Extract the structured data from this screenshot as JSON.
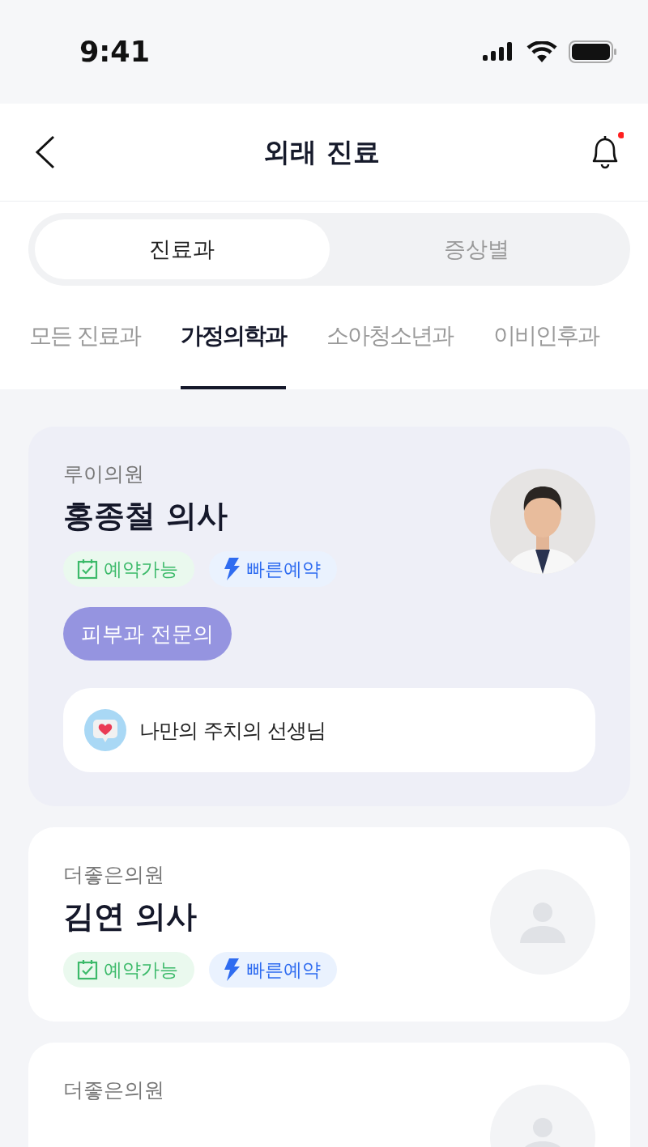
{
  "status_bar": {
    "time": "9:41"
  },
  "header": {
    "title": "외래 진료",
    "notification": true
  },
  "segments": [
    {
      "label": "진료과",
      "selected": true
    },
    {
      "label": "증상별",
      "selected": false
    }
  ],
  "categories": [
    {
      "label": "모든 진료과",
      "selected": false
    },
    {
      "label": "가정의학과",
      "selected": true
    },
    {
      "label": "소아청소년과",
      "selected": false
    },
    {
      "label": "이비인후과",
      "selected": false
    }
  ],
  "doctors": [
    {
      "clinic": "루이의원",
      "name": "홍종철 의사",
      "photo": true,
      "selected": true,
      "badges": [
        {
          "kind": "available",
          "label": "예약가능"
        },
        {
          "kind": "fast",
          "label": "빠른예약"
        }
      ],
      "specialty": "피부과 전문의",
      "note": "나만의 주치의 선생님"
    },
    {
      "clinic": "더좋은의원",
      "name": "김연 의사",
      "photo": false,
      "selected": false,
      "badges": [
        {
          "kind": "available",
          "label": "예약가능"
        },
        {
          "kind": "fast",
          "label": "빠른예약"
        }
      ]
    },
    {
      "clinic": "더좋은의원",
      "photo": false,
      "selected": false
    }
  ]
}
